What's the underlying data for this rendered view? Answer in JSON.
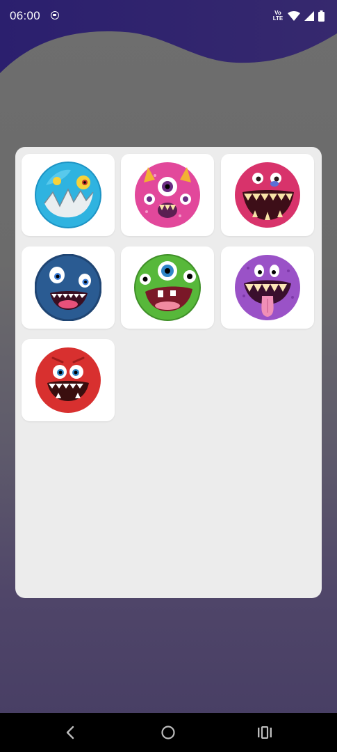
{
  "status_bar": {
    "time": "06:00",
    "network_label_top": "Vo",
    "network_label_bottom": "LTE",
    "icons": [
      "screen-record-icon",
      "volte-icon",
      "wifi-icon",
      "signal-icon",
      "battery-icon"
    ]
  },
  "monsters": [
    {
      "name": "blue-spiky-monster",
      "color": "#2fb3e0"
    },
    {
      "name": "pink-three-eyed-monster",
      "color": "#e2489b"
    },
    {
      "name": "crimson-grinning-monster",
      "color": "#d8336b"
    },
    {
      "name": "navy-round-monster",
      "color": "#2a5b92"
    },
    {
      "name": "green-cyclops-monster",
      "color": "#57b83a"
    },
    {
      "name": "purple-tongue-monster",
      "color": "#9a52c7"
    },
    {
      "name": "red-happy-monster",
      "color": "#d8302f"
    }
  ],
  "nav_bar": {
    "icons": [
      "back-icon",
      "home-icon",
      "recents-icon"
    ]
  },
  "colors": {
    "header_wave": "#2d2270",
    "panel": "#ececec",
    "card": "#ffffff"
  }
}
